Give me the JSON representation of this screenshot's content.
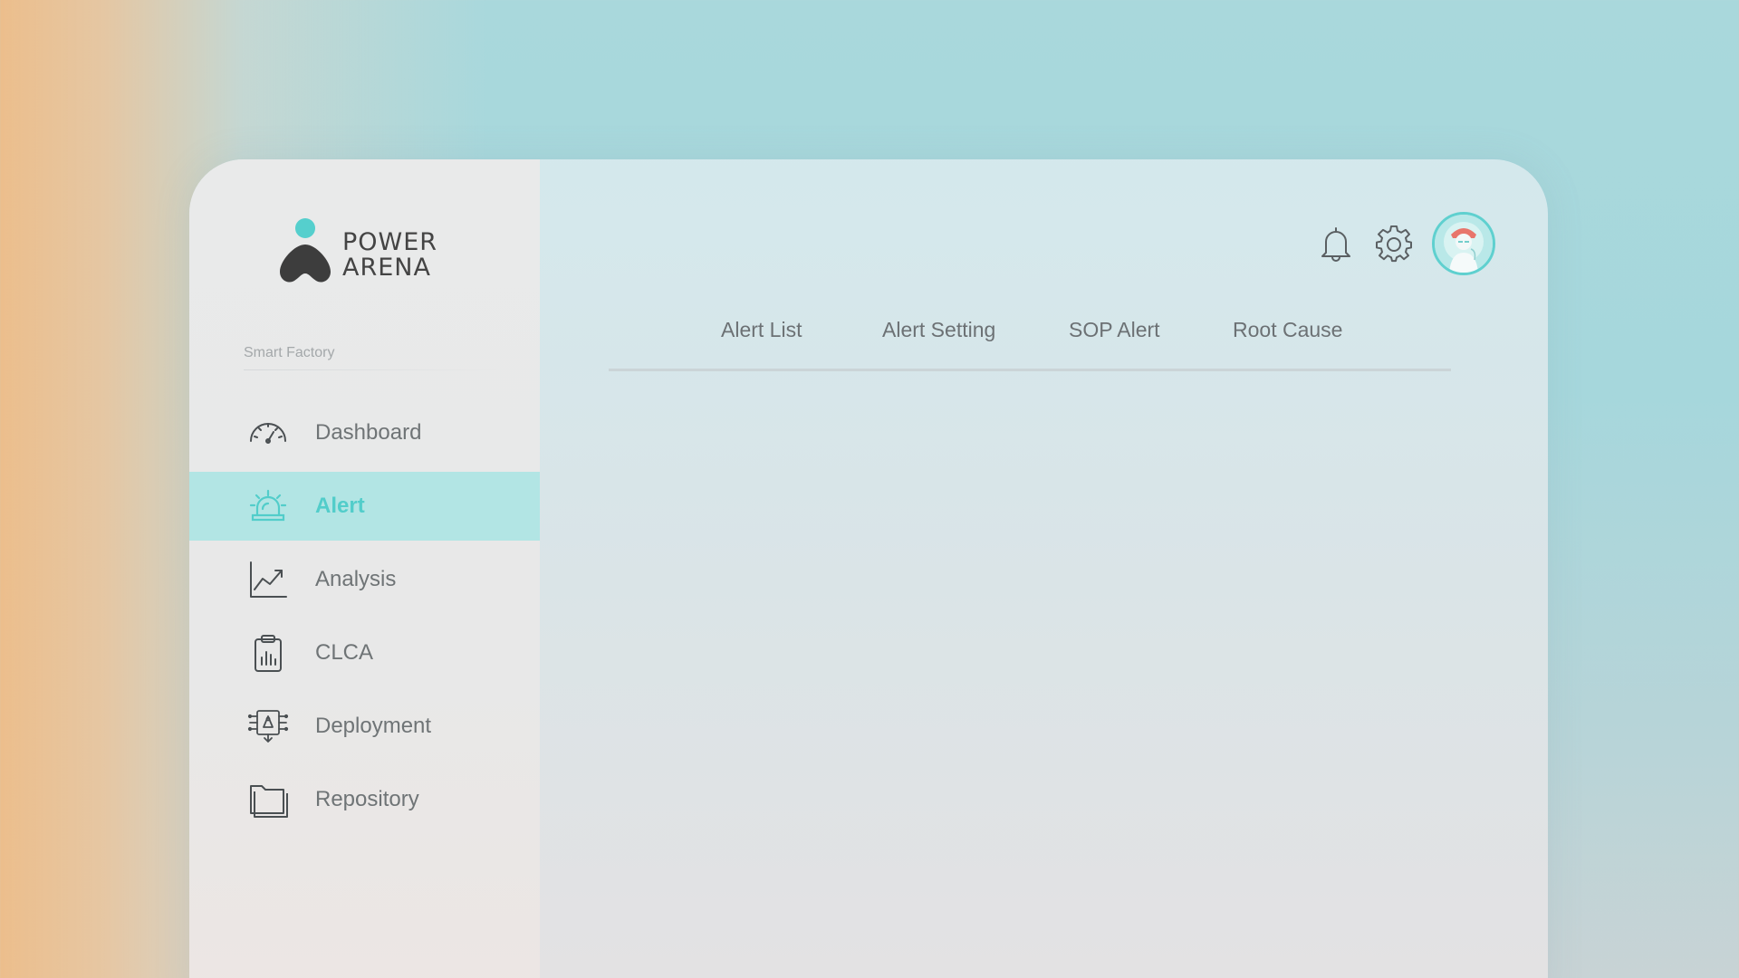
{
  "brand": {
    "line1": "POWER",
    "line2": "ARENA",
    "accent_color": "#55cfcd"
  },
  "sidebar": {
    "section_label": "Smart Factory",
    "items": [
      {
        "label": "Dashboard",
        "icon": "speedometer-icon",
        "active": false
      },
      {
        "label": "Alert",
        "icon": "siren-icon",
        "active": true
      },
      {
        "label": "Analysis",
        "icon": "line-chart-icon",
        "active": false
      },
      {
        "label": "CLCA",
        "icon": "clipboard-chart-icon",
        "active": false
      },
      {
        "label": "Deployment",
        "icon": "deployment-icon",
        "active": false
      },
      {
        "label": "Repository",
        "icon": "folder-icon",
        "active": false
      }
    ]
  },
  "header": {
    "icons": [
      "bell-icon",
      "gear-icon"
    ],
    "avatar": "user-avatar"
  },
  "tabs": [
    {
      "label": "Alert List"
    },
    {
      "label": "Alert Setting"
    },
    {
      "label": "SOP Alert"
    },
    {
      "label": "Root Cause"
    }
  ],
  "colors": {
    "active_bg": "#b2e5e4",
    "active_text": "#52cdca",
    "text": "#6f7476"
  }
}
